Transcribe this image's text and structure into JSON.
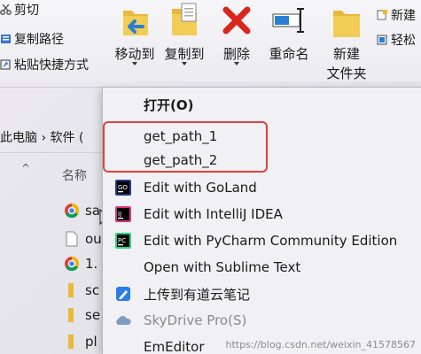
{
  "ribbon": {
    "clipboard": {
      "cut": "剪切",
      "copy_path": "复制路径",
      "paste_shortcut": "粘贴快捷方式"
    },
    "buttons": {
      "move_to": "移动到",
      "copy_to": "复制到",
      "delete": "删除",
      "rename": "重命名",
      "new_folder_line1": "新建",
      "new_folder_line2": "文件夹"
    },
    "right_items": [
      "新建",
      "轻松"
    ]
  },
  "nav": {
    "breadcrumb": "此电脑 › 软件 (",
    "column_name": "名称"
  },
  "files": [
    {
      "name": "sa",
      "icon": "chrome-icon"
    },
    {
      "name": "ou",
      "icon": "file-icon"
    },
    {
      "name": "1.",
      "icon": "chrome-icon"
    },
    {
      "name": "sc",
      "icon": "folder-icon"
    },
    {
      "name": "se",
      "icon": "folder-icon"
    },
    {
      "name": "pl",
      "icon": "folder-icon"
    }
  ],
  "context_menu": {
    "items": [
      {
        "label": "打开(O)",
        "icon": "",
        "bold": true,
        "disabled": false
      },
      {
        "label": "get_path_1",
        "icon": "",
        "bold": false,
        "disabled": false
      },
      {
        "label": "get_path_2",
        "icon": "",
        "bold": false,
        "disabled": false
      },
      {
        "label": "Edit with GoLand",
        "icon": "goland-icon",
        "bold": false,
        "disabled": false
      },
      {
        "label": "Edit with IntelliJ IDEA",
        "icon": "intellij-icon",
        "bold": false,
        "disabled": false
      },
      {
        "label": "Edit with PyCharm Community Edition",
        "icon": "pycharm-icon",
        "bold": false,
        "disabled": false
      },
      {
        "label": "Open with Sublime Text",
        "icon": "",
        "bold": false,
        "disabled": false
      },
      {
        "label": "上传到有道云笔记",
        "icon": "youdao-note-icon",
        "bold": false,
        "disabled": false
      },
      {
        "label": "SkyDrive Pro(S)",
        "icon": "skydrive-icon",
        "bold": false,
        "disabled": true
      },
      {
        "label": "EmEditor",
        "icon": "",
        "bold": false,
        "disabled": false
      }
    ]
  },
  "watermark": "https://blog.csdn.net/weixin_41578567",
  "colors": {
    "highlight_border": "#e0413a",
    "delete_red": "#d8261c",
    "folder_yellow": "#e8b93a",
    "move_blue": "#2a7fd4"
  }
}
